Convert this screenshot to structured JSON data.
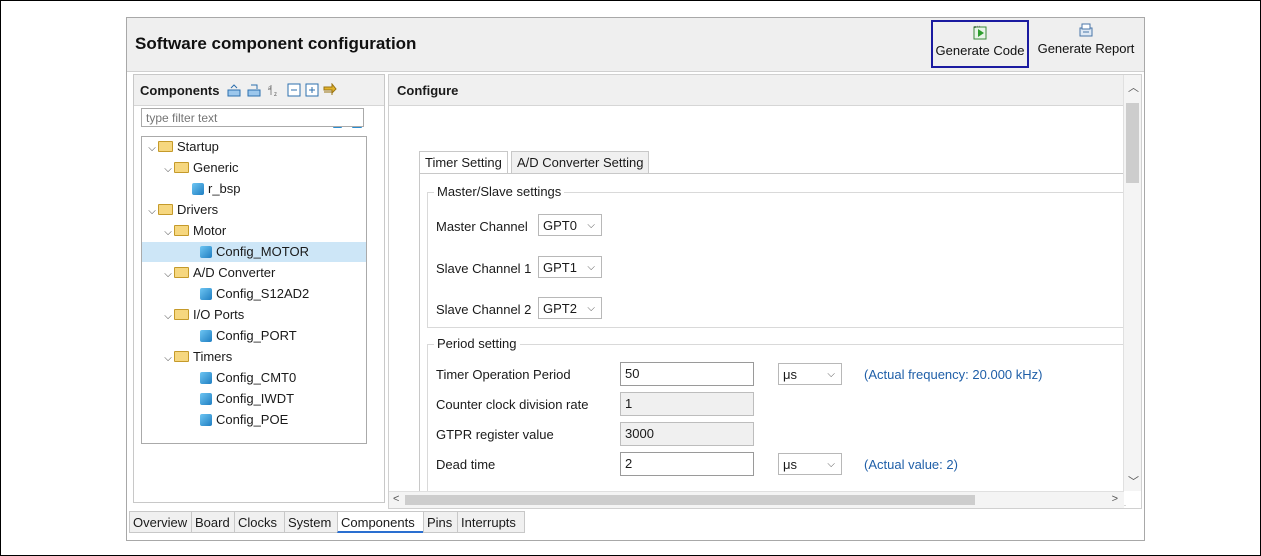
{
  "window": {
    "title": "Software component configuration"
  },
  "toolbar": {
    "generate_code_label": "Generate Code",
    "generate_report_label": "Generate Report"
  },
  "components_panel": {
    "title": "Components",
    "filter_placeholder": "type filter text",
    "tree": [
      {
        "label": "Startup",
        "type": "folder"
      },
      {
        "label": "Generic",
        "type": "folder"
      },
      {
        "label": "r_bsp",
        "type": "component"
      },
      {
        "label": "Drivers",
        "type": "folder"
      },
      {
        "label": "Motor",
        "type": "folder"
      },
      {
        "label": "Config_MOTOR",
        "type": "component",
        "selected": true
      },
      {
        "label": "A/D Converter",
        "type": "folder"
      },
      {
        "label": "Config_S12AD2",
        "type": "component"
      },
      {
        "label": "I/O Ports",
        "type": "folder"
      },
      {
        "label": "Config_PORT",
        "type": "component"
      },
      {
        "label": "Timers",
        "type": "folder"
      },
      {
        "label": "Config_CMT0",
        "type": "component"
      },
      {
        "label": "Config_IWDT",
        "type": "component"
      },
      {
        "label": "Config_POE",
        "type": "component"
      }
    ]
  },
  "configure_panel": {
    "title": "Configure",
    "tabs": [
      "Timer Setting",
      "A/D Converter Setting"
    ],
    "master_slave": {
      "title": "Master/Slave settings",
      "master_label": "Master Channel",
      "master_value": "GPT0",
      "slave1_label": "Slave Channel 1",
      "slave1_value": "GPT1",
      "slave2_label": "Slave Channel 2",
      "slave2_value": "GPT2"
    },
    "period": {
      "title": "Period setting",
      "timer_period_label": "Timer Operation Period",
      "timer_period_value": "50",
      "timer_period_unit": "μs",
      "timer_period_note": "(Actual frequency: 20.000 kHz)",
      "division_label": "Counter clock division rate",
      "division_value": "1",
      "gtpr_label": "GTPR register value",
      "gtpr_value": "3000",
      "dead_time_label": "Dead time",
      "dead_time_value": "2",
      "dead_time_unit": "μs",
      "dead_time_note": "(Actual value: 2)"
    }
  },
  "bottom_tabs": [
    "Overview",
    "Board",
    "Clocks",
    "System",
    "Components",
    "Pins",
    "Interrupts"
  ],
  "colors": {
    "selection": "#cde6f7",
    "highlight_border": "#1a1aa0",
    "note": "#1f5fa8"
  }
}
